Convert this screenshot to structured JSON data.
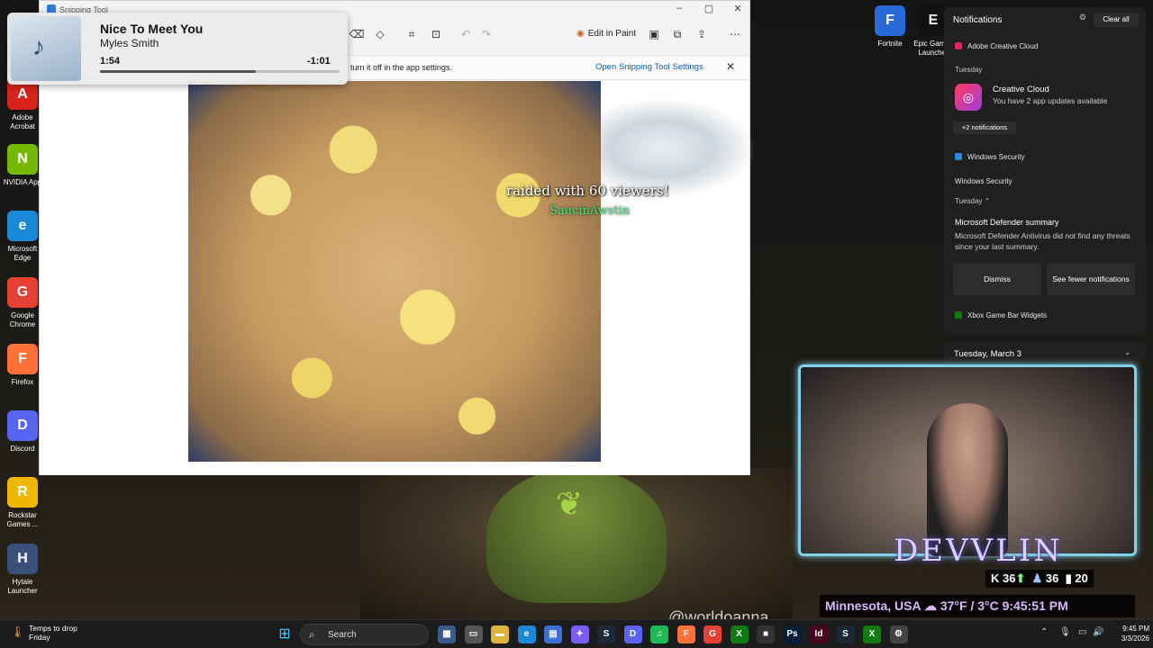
{
  "media": {
    "song": "Nice To Meet You",
    "artist": "Myles Smith",
    "elapsed": "1:54",
    "remaining": "-1:01",
    "progress_fraction": 0.65
  },
  "snipping_tool": {
    "title": "Snipping Tool",
    "edit_in_paint": "Edit in Paint",
    "info_text": "turn it off in the app settings.",
    "info_link": "Open Snipping Tool Settings",
    "raid_text": "raided with 60 viewers!",
    "raid_name": "SaucinAwstin"
  },
  "desktop": {
    "left_icons": [
      {
        "label": "Adobe Acrobat",
        "glyph": "A",
        "color": "#d8231a"
      },
      {
        "label": "NVIDIA App",
        "glyph": "N",
        "color": "#76b900"
      },
      {
        "label": "Microsoft Edge",
        "glyph": "e",
        "color": "#1a8ad8"
      },
      {
        "label": "Google Chrome",
        "glyph": "G",
        "color": "#e44134"
      },
      {
        "label": "Firefox",
        "glyph": "F",
        "color": "#ff7139"
      },
      {
        "label": "Discord",
        "glyph": "D",
        "color": "#5865f2"
      },
      {
        "label": "Rockstar Games ...",
        "glyph": "R",
        "color": "#f0b700"
      },
      {
        "label": "Hytale Launcher",
        "glyph": "H",
        "color": "#3a4f7a"
      }
    ],
    "fortnite_label": "Fortnite",
    "epic_label": "Epic Games Launcher",
    "watermark": "@worldoanna"
  },
  "notifications": {
    "title": "Notifications",
    "clear_all": "Clear all",
    "adobe_app": "Adobe Creative Cloud",
    "day1": "Tuesday",
    "cc_title": "Creative Cloud",
    "cc_body": "You have 2 app updates available",
    "more": "+2 notifications",
    "winsec_app": "Windows Security",
    "winsec_group": "Windows Security",
    "day2": "Tuesday",
    "def_title": "Microsoft Defender summary",
    "def_body": "Microsoft Defender Antivirus did not find any threats since your last summary.",
    "dismiss": "Dismiss",
    "see_fewer": "See fewer notifications",
    "xbox": "Xbox Game Bar Widgets",
    "date": "Tuesday, March 3"
  },
  "stream": {
    "brand": "DEVVLIN",
    "stat1": "36",
    "stat2": "36",
    "stat3": "20",
    "location": "Minnesota, USA",
    "weather": "37°F / 3°C",
    "time": "9:45:51 PM"
  },
  "taskbar": {
    "weather_line1": "Temps to drop",
    "weather_line2": "Friday",
    "search": "Search",
    "clock_time": "9:45 PM",
    "clock_date": "3/3/2026",
    "apps": [
      {
        "name": "widgets",
        "glyph": "▦",
        "color": "#3a5a8a"
      },
      {
        "name": "task-view",
        "glyph": "▭",
        "color": "#555"
      },
      {
        "name": "file-explorer",
        "glyph": "▬",
        "color": "#e0b43a"
      },
      {
        "name": "edge",
        "glyph": "e",
        "color": "#1a8ad8"
      },
      {
        "name": "store",
        "glyph": "▤",
        "color": "#3d6fd6"
      },
      {
        "name": "copilot",
        "glyph": "✦",
        "color": "#7c5cff"
      },
      {
        "name": "steam",
        "glyph": "S",
        "color": "#1b2838"
      },
      {
        "name": "discord",
        "glyph": "D",
        "color": "#5865f2"
      },
      {
        "name": "spotify",
        "glyph": "♫",
        "color": "#1db954"
      },
      {
        "name": "firefox",
        "glyph": "F",
        "color": "#ff7139"
      },
      {
        "name": "chrome",
        "glyph": "G",
        "color": "#e44134"
      },
      {
        "name": "xbox",
        "glyph": "X",
        "color": "#107c10"
      },
      {
        "name": "app-dark",
        "glyph": "■",
        "color": "#333"
      },
      {
        "name": "photoshop",
        "glyph": "Ps",
        "color": "#001e36"
      },
      {
        "name": "indesign",
        "glyph": "Id",
        "color": "#49021f"
      },
      {
        "name": "steam-2",
        "glyph": "S",
        "color": "#1b2838"
      },
      {
        "name": "xbox-2",
        "glyph": "X",
        "color": "#107c10"
      },
      {
        "name": "settings",
        "glyph": "⚙",
        "color": "#444"
      }
    ]
  }
}
